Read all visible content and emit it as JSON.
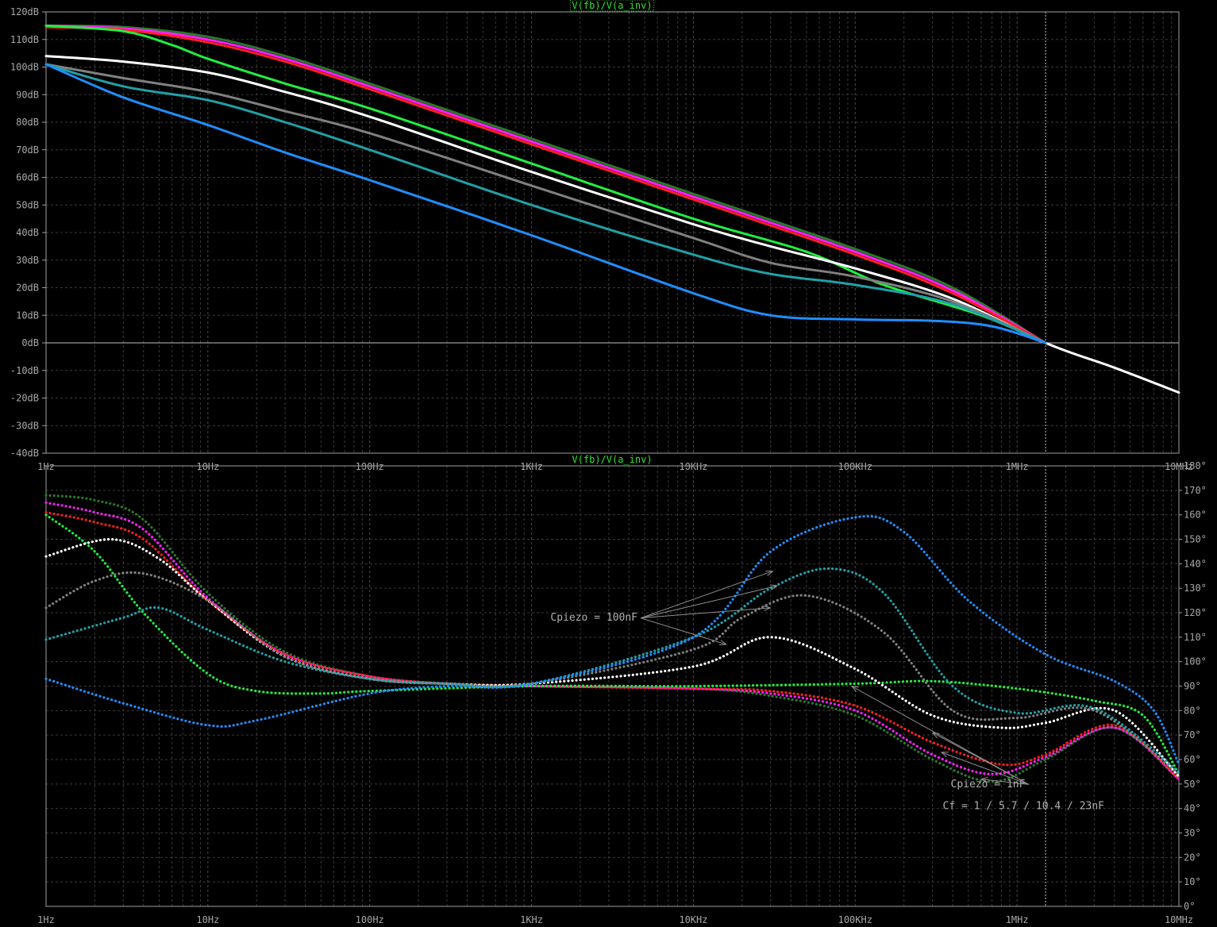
{
  "colors": {
    "background": "#000000",
    "frame": "#a0a0a0",
    "grid": "#3a3a3a",
    "tick_text": "#a8a8a8",
    "title_text": "#30e030",
    "annotation": "#b0b0b0"
  },
  "chart_data": [
    {
      "type": "line",
      "title": "V(fb)/V(a_inv)",
      "quantity": "magnitude",
      "x_scale": "log",
      "xlim": [
        1,
        10000000
      ],
      "ylim": [
        -40,
        120
      ],
      "y_unit": "dB",
      "grid": true,
      "cursor_x": 1500000,
      "x_tick_labels": [
        "1Hz",
        "10Hz",
        "100Hz",
        "1KHz",
        "10KHz",
        "100KHz",
        "1MHz",
        "10MHz"
      ],
      "y_tick_labels": [
        "120dB",
        "110dB",
        "100dB",
        "90dB",
        "80dB",
        "70dB",
        "60dB",
        "50dB",
        "40dB",
        "30dB",
        "20dB",
        "10dB",
        "0dB",
        "-10dB",
        "-20dB",
        "-30dB",
        "-40dB"
      ],
      "series": [
        {
          "color": "#2a7a2a",
          "style": "solid",
          "x": [
            1,
            3,
            10,
            30,
            100,
            1000,
            10000,
            100000,
            400000,
            1500000
          ],
          "y": [
            115,
            114.5,
            111,
            104,
            94,
            74,
            54,
            34,
            20,
            0
          ]
        },
        {
          "color": "#ff20ff",
          "style": "solid",
          "x": [
            1,
            3,
            10,
            30,
            100,
            1000,
            10000,
            100000,
            400000,
            1500000
          ],
          "y": [
            115,
            114,
            110,
            103,
            93,
            73,
            53,
            33,
            19,
            0
          ]
        },
        {
          "color": "#ff2020",
          "style": "solid",
          "x": [
            1,
            3,
            10,
            30,
            100,
            1000,
            10000,
            100000,
            400000,
            1500000
          ],
          "y": [
            114.5,
            113.5,
            109,
            102,
            92,
            72,
            52,
            32,
            18,
            0
          ]
        },
        {
          "color": "#20ee40",
          "style": "solid",
          "x": [
            1,
            3,
            6,
            10,
            30,
            100,
            1000,
            10000,
            50000,
            150000,
            600000,
            1500000
          ],
          "y": [
            115,
            113,
            108,
            103,
            94,
            85,
            65,
            45,
            33,
            21,
            10,
            0
          ]
        },
        {
          "color": "#ffffff",
          "style": "solid",
          "x": [
            1,
            3,
            10,
            30,
            100,
            1000,
            10000,
            30000,
            100000,
            400000,
            1500000,
            4000000,
            10000000
          ],
          "y": [
            104,
            102,
            98,
            91,
            82,
            62,
            43,
            35,
            27,
            16,
            0,
            -9,
            -18
          ]
        },
        {
          "color": "#808080",
          "style": "solid",
          "x": [
            1,
            3,
            10,
            30,
            100,
            1000,
            10000,
            30000,
            100000,
            400000,
            1500000
          ],
          "y": [
            101,
            96,
            91,
            84,
            76,
            57,
            38,
            29,
            24,
            15,
            0
          ]
        },
        {
          "color": "#20a0a8",
          "style": "solid",
          "x": [
            1,
            3,
            10,
            30,
            100,
            1000,
            10000,
            30000,
            100000,
            400000,
            1500000
          ],
          "y": [
            101,
            93,
            88,
            80,
            70,
            50,
            32,
            25,
            21,
            14,
            0
          ]
        },
        {
          "color": "#1f8fff",
          "style": "solid",
          "x": [
            1,
            3,
            10,
            30,
            100,
            1000,
            10000,
            30000,
            100000,
            300000,
            700000,
            1500000
          ],
          "y": [
            101,
            89,
            79,
            69,
            59,
            39,
            18,
            10,
            8.5,
            8,
            6,
            0
          ]
        }
      ]
    },
    {
      "type": "line",
      "title": "V(fb)/V(a_inv)",
      "quantity": "phase",
      "x_scale": "log",
      "xlim": [
        1,
        10000000
      ],
      "ylim": [
        0,
        180
      ],
      "y_unit": "°",
      "grid": true,
      "cursor_x": 1500000,
      "x_tick_labels": [
        "1Hz",
        "10Hz",
        "100Hz",
        "1KHz",
        "10KHz",
        "100KHz",
        "1MHz",
        "10MHz"
      ],
      "y_tick_labels": [
        "180°",
        "170°",
        "160°",
        "150°",
        "140°",
        "130°",
        "120°",
        "110°",
        "100°",
        "90°",
        "80°",
        "70°",
        "60°",
        "50°",
        "40°",
        "30°",
        "20°",
        "10°",
        "0°"
      ],
      "annotations": [
        {
          "text": "Cpiezo = 100nF",
          "x": 10000,
          "y": 118
        },
        {
          "text": "Cpiezo = 1nF",
          "x": 80000,
          "y": 50
        },
        {
          "text": "Cf = 1 / 5.7 / 10.4 / 23nF",
          "x": 80000,
          "y": 41
        }
      ],
      "series": [
        {
          "color": "#2a7a2a",
          "style": "dotted",
          "x": [
            1,
            2,
            4,
            10,
            30,
            100,
            300,
            1000,
            10000,
            30000,
            100000,
            300000,
            700000,
            1500000,
            4000000,
            10000000
          ],
          "y": [
            168,
            166,
            158,
            128,
            104,
            94,
            91,
            90,
            89,
            86,
            78,
            60,
            51,
            60,
            73,
            52
          ]
        },
        {
          "color": "#ff20ff",
          "style": "dotted",
          "x": [
            1,
            2,
            4,
            10,
            30,
            100,
            300,
            1000,
            10000,
            30000,
            100000,
            300000,
            700000,
            1500000,
            4000000,
            10000000
          ],
          "y": [
            165,
            161,
            154,
            126,
            103,
            94,
            91,
            90,
            89,
            87,
            80,
            62,
            54,
            61,
            73,
            52
          ]
        },
        {
          "color": "#ff2020",
          "style": "dotted",
          "x": [
            1,
            2,
            4,
            10,
            30,
            100,
            300,
            1000,
            10000,
            30000,
            100000,
            300000,
            800000,
            1500000,
            4000000,
            10000000
          ],
          "y": [
            161,
            157,
            150,
            125,
            103,
            94,
            91,
            90,
            89,
            88,
            82,
            67,
            58,
            62,
            74,
            52
          ]
        },
        {
          "color": "#20ee40",
          "style": "dotted",
          "x": [
            1,
            2,
            4,
            10,
            20,
            50,
            100,
            1000,
            10000,
            100000,
            300000,
            1000000,
            3000000,
            6000000,
            10000000
          ],
          "y": [
            160,
            145,
            120,
            95,
            88,
            87,
            88,
            90,
            90,
            91,
            92,
            89,
            84,
            78,
            54
          ]
        },
        {
          "color": "#ffffff",
          "style": "dotted",
          "x": [
            1,
            2.5,
            5,
            10,
            30,
            100,
            300,
            1000,
            10000,
            30000,
            100000,
            300000,
            800000,
            1500000,
            4000000,
            10000000
          ],
          "y": [
            143,
            150,
            142,
            125,
            102,
            93,
            91,
            91,
            98,
            110,
            97,
            78,
            73,
            75,
            80,
            53
          ]
        },
        {
          "color": "#808080",
          "style": "dotted",
          "x": [
            1,
            2,
            4,
            10,
            30,
            100,
            300,
            1000,
            10000,
            20000,
            50000,
            150000,
            400000,
            1000000,
            3000000,
            10000000
          ],
          "y": [
            122,
            133,
            136,
            125,
            102,
            93,
            91,
            91,
            105,
            118,
            127,
            112,
            80,
            77,
            80,
            54
          ]
        },
        {
          "color": "#20a0a8",
          "style": "dotted",
          "x": [
            1,
            3,
            5,
            10,
            30,
            100,
            300,
            1000,
            10000,
            30000,
            70000,
            150000,
            400000,
            1000000,
            3000000,
            10000000
          ],
          "y": [
            109,
            118,
            122,
            113,
            100,
            93,
            91,
            91,
            110,
            130,
            138,
            128,
            90,
            79,
            81,
            55
          ]
        },
        {
          "color": "#1f8fff",
          "style": "dotted",
          "x": [
            1,
            3,
            10,
            20,
            100,
            300,
            1000,
            10000,
            30000,
            100000,
            200000,
            500000,
            1500000,
            4000000,
            7000000,
            10000000
          ],
          "y": [
            93,
            83,
            74,
            76,
            87,
            90,
            91,
            110,
            145,
            159,
            153,
            125,
            103,
            92,
            80,
            58
          ]
        }
      ]
    }
  ]
}
